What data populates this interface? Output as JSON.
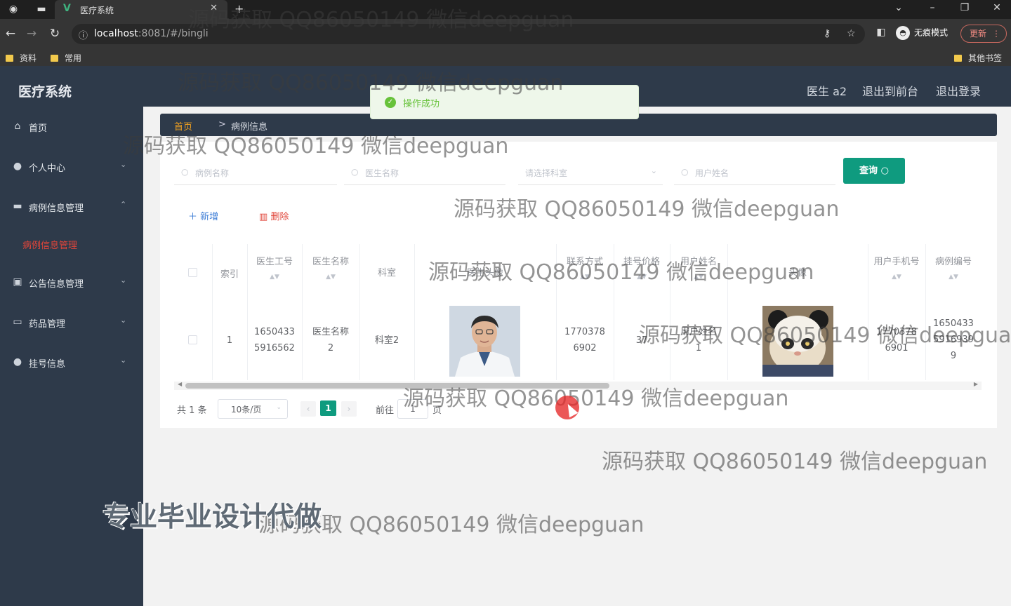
{
  "browser": {
    "tab_title": "医疗系统",
    "tab_logo": "V",
    "url_host": "localhost",
    "url_rest": ":8081/#/bingli",
    "incognito_label": "无痕模式",
    "update_label": "更新",
    "bookmarks": [
      "资料",
      "常用"
    ],
    "other_bookmarks": "其他书签"
  },
  "header": {
    "logo": "医疗系统",
    "links": [
      "医生 a2",
      "退出到前台",
      "退出登录"
    ]
  },
  "sidebar": {
    "items": [
      {
        "label": "首页",
        "icon": "home-icon",
        "glyph": "⌂"
      },
      {
        "label": "个人中心",
        "icon": "user-icon",
        "glyph": "●",
        "arrow": "⌄"
      },
      {
        "label": "病例信息管理",
        "icon": "briefcase-icon",
        "glyph": "▬",
        "arrow": "⌃"
      },
      {
        "label": "公告信息管理",
        "icon": "picture-icon",
        "glyph": "▣",
        "arrow": "⌄"
      },
      {
        "label": "药品管理",
        "icon": "chat-icon",
        "glyph": "▭",
        "arrow": "⌄"
      },
      {
        "label": "挂号信息",
        "icon": "user-icon",
        "glyph": "●",
        "arrow": "⌄"
      }
    ],
    "sub_item": "病例信息管理"
  },
  "breadcrumb": {
    "home": "首页",
    "sep": ">",
    "current": "病例信息"
  },
  "search": {
    "case_name_placeholder": "病例名称",
    "doctor_name_placeholder": "医生名称",
    "department_placeholder": "请选择科室",
    "user_name_placeholder": "用户姓名",
    "query_label": "查询"
  },
  "actions": {
    "add": "新增",
    "delete": "删除"
  },
  "table": {
    "headers": [
      "索引",
      "医生工号",
      "医生名称",
      "科室",
      "医生头像",
      "联系方式",
      "挂号价格",
      "用户姓名",
      "头像",
      "用户手机号",
      "病例编号"
    ],
    "row": {
      "index": "1",
      "doctor_no": "1650433\n5916562",
      "doctor_name": "医生名称\n2",
      "department": "科室2",
      "contact": "1770378\n6902",
      "price": "37",
      "user_name": "用户姓名\n1",
      "user_phone": "1770378\n6901",
      "case_no": "1650433\n5916939\n9"
    }
  },
  "pagination": {
    "total": "共 1 条",
    "page_size": "10条/页",
    "current_page": "1",
    "goto_label": "前往",
    "goto_value": "1",
    "page_suffix": "页"
  },
  "toast": {
    "message": "操作成功"
  },
  "watermark": {
    "text": "源码获取 QQ86050149 微信deepguan",
    "big": "专业毕业设计代做"
  },
  "colors": {
    "primary": "#0f9b7f",
    "sidebar": "#2e3a4a",
    "danger": "#e0453a",
    "link": "#3a7bd5",
    "success": "#67c23a"
  }
}
